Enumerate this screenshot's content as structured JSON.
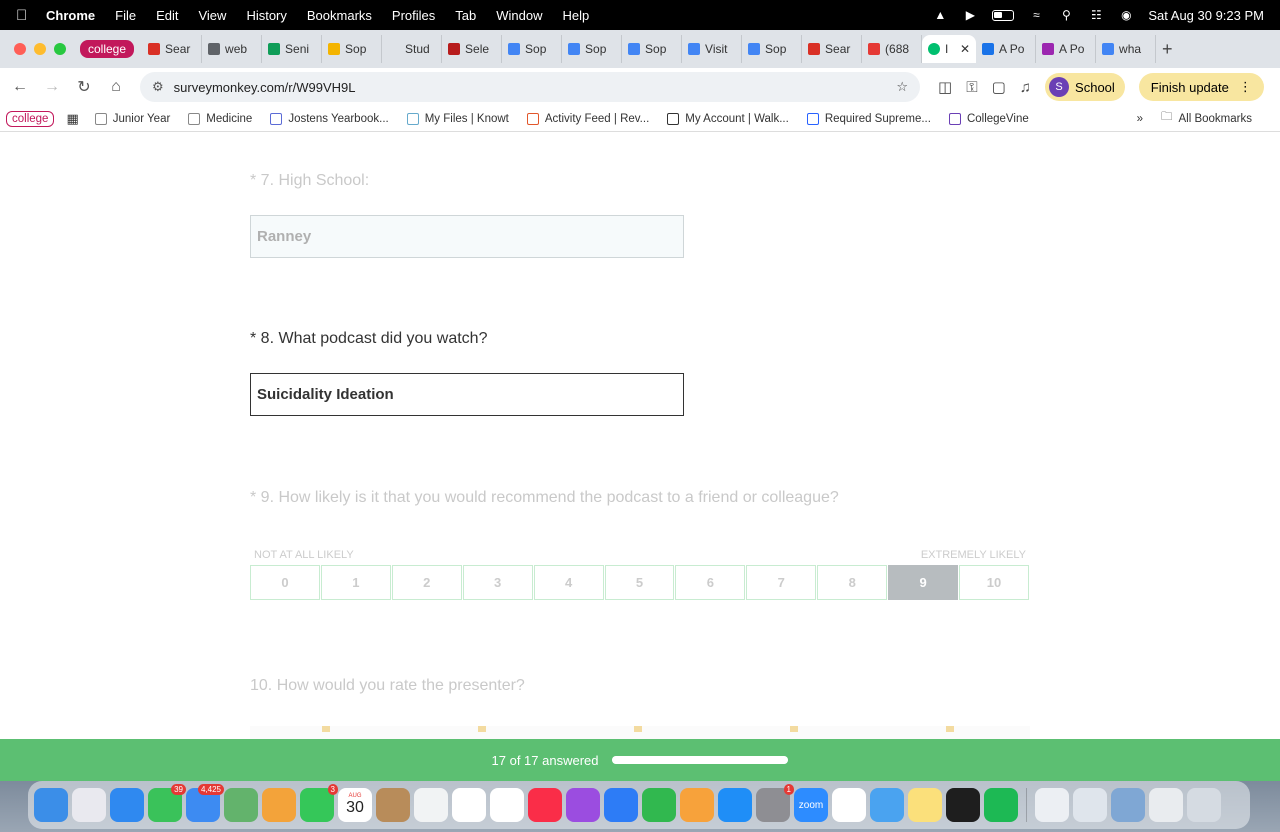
{
  "menubar": {
    "app": "Chrome",
    "items": [
      "File",
      "Edit",
      "View",
      "History",
      "Bookmarks",
      "Profiles",
      "Tab",
      "Window",
      "Help"
    ],
    "datetime": "Sat Aug 30  9:23 PM"
  },
  "tabs": {
    "group_label": "college",
    "items": [
      {
        "label": "Sear",
        "color": "#d93025"
      },
      {
        "label": "web",
        "color": "#5f6368"
      },
      {
        "label": "Seni",
        "color": "#0f9d58"
      },
      {
        "label": "Sop",
        "color": "#f4b400"
      },
      {
        "label": "Stud",
        "color": "#dfe3e8"
      },
      {
        "label": "Sele",
        "color": "#b71c1c"
      },
      {
        "label": "Sop",
        "color": "#4285f4"
      },
      {
        "label": "Sop",
        "color": "#4285f4"
      },
      {
        "label": "Sop",
        "color": "#4285f4"
      },
      {
        "label": "Visit",
        "color": "#4285f4"
      },
      {
        "label": "Sop",
        "color": "#4285f4"
      },
      {
        "label": "Sear",
        "color": "#d93025"
      },
      {
        "label": "(688",
        "color": "#e53935"
      }
    ],
    "active_label": "I",
    "after_items": [
      {
        "label": "A Po",
        "color": "#1a73e8"
      },
      {
        "label": "A Po",
        "color": "#9c27b0"
      },
      {
        "label": "wha",
        "color": "#4285f4"
      }
    ]
  },
  "toolbar": {
    "url": "surveymonkey.com/r/W99VH9L",
    "profile_initial": "S",
    "profile_label": "School",
    "update_label": "Finish update"
  },
  "bookmarks": {
    "group_label": "college",
    "items": [
      "Junior Year",
      "Medicine",
      "Jostens Yearbook...",
      "My Files | Knowt",
      "Activity Feed | Rev...",
      "My Account | Walk...",
      "Required Supreme...",
      "CollegeVine"
    ],
    "all_label": "All Bookmarks"
  },
  "survey": {
    "q7": {
      "label": "* 7. High School:",
      "value": "Ranney"
    },
    "q8": {
      "label": "* 8. What podcast did you watch?",
      "value": "Suicidality Ideation"
    },
    "q9": {
      "label": "* 9. How likely is it that you would recommend the podcast to a friend or colleague?",
      "low_label": "NOT AT ALL LIKELY",
      "high_label": "EXTREMELY LIKELY",
      "options": [
        "0",
        "1",
        "2",
        "3",
        "4",
        "5",
        "6",
        "7",
        "8",
        "9",
        "10"
      ],
      "selected": "9"
    },
    "q10": {
      "label": "10. How would you rate the presenter?"
    }
  },
  "progress": {
    "label": "17 of 17 answered",
    "fraction": 1.0
  },
  "dock": {
    "apps": [
      {
        "name": "finder-icon",
        "color": "#3b8ee8",
        "badge": ""
      },
      {
        "name": "launchpad-icon",
        "color": "#e9e9ef",
        "badge": ""
      },
      {
        "name": "safari-icon",
        "color": "#2f89f0",
        "badge": ""
      },
      {
        "name": "messages-icon",
        "color": "#3ac25a",
        "badge": "39"
      },
      {
        "name": "mail-icon",
        "color": "#3d8bf2",
        "badge": "4,425"
      },
      {
        "name": "maps-icon",
        "color": "#63b36c",
        "badge": ""
      },
      {
        "name": "photos-icon",
        "color": "#f3a33a",
        "badge": ""
      },
      {
        "name": "facetime-icon",
        "color": "#35c759",
        "badge": "3"
      },
      {
        "name": "calendar-icon",
        "color": "#ffffff",
        "badge": ""
      },
      {
        "name": "contacts-icon",
        "color": "#b88c5a",
        "badge": ""
      },
      {
        "name": "drive-icon",
        "color": "#f1f3f4",
        "badge": ""
      },
      {
        "name": "reminders-icon",
        "color": "#ffffff",
        "badge": ""
      },
      {
        "name": "freeform-icon",
        "color": "#ffffff",
        "badge": ""
      },
      {
        "name": "music-icon",
        "color": "#fa2d48",
        "badge": ""
      },
      {
        "name": "podcasts-icon",
        "color": "#9b4de0",
        "badge": ""
      },
      {
        "name": "keynote-icon",
        "color": "#2d7cf6",
        "badge": ""
      },
      {
        "name": "numbers-icon",
        "color": "#31b84f",
        "badge": ""
      },
      {
        "name": "pages-icon",
        "color": "#f7a23b",
        "badge": ""
      },
      {
        "name": "app-store-icon",
        "color": "#1f8ef7",
        "badge": ""
      },
      {
        "name": "settings-icon",
        "color": "#8e8e93",
        "badge": "1"
      },
      {
        "name": "zoom-icon",
        "color": "#2d8cff",
        "badge": ""
      },
      {
        "name": "chrome-icon",
        "color": "#ffffff",
        "badge": ""
      },
      {
        "name": "weather-icon",
        "color": "#4aa3f0",
        "badge": ""
      },
      {
        "name": "notes-icon",
        "color": "#fbe07b",
        "badge": ""
      },
      {
        "name": "activity-monitor-icon",
        "color": "#1e1e1e",
        "badge": ""
      },
      {
        "name": "spotify-icon",
        "color": "#1db954",
        "badge": ""
      },
      {
        "name": "window-thumb-1-icon",
        "color": "#eceff3",
        "badge": ""
      },
      {
        "name": "window-thumb-2-icon",
        "color": "#dfe5ec",
        "badge": ""
      },
      {
        "name": "window-thumb-3-icon",
        "color": "#7fa7d4",
        "badge": ""
      },
      {
        "name": "window-thumb-4-icon",
        "color": "#e9ecef",
        "badge": ""
      },
      {
        "name": "trash-icon",
        "color": "#d5dbe2",
        "badge": ""
      }
    ],
    "zoom_label": "zoom",
    "calendar_month": "AUG",
    "calendar_day": "30"
  },
  "colors": {
    "accent_green": "#5cbf72",
    "selected_cell": "#b7bcbf"
  }
}
